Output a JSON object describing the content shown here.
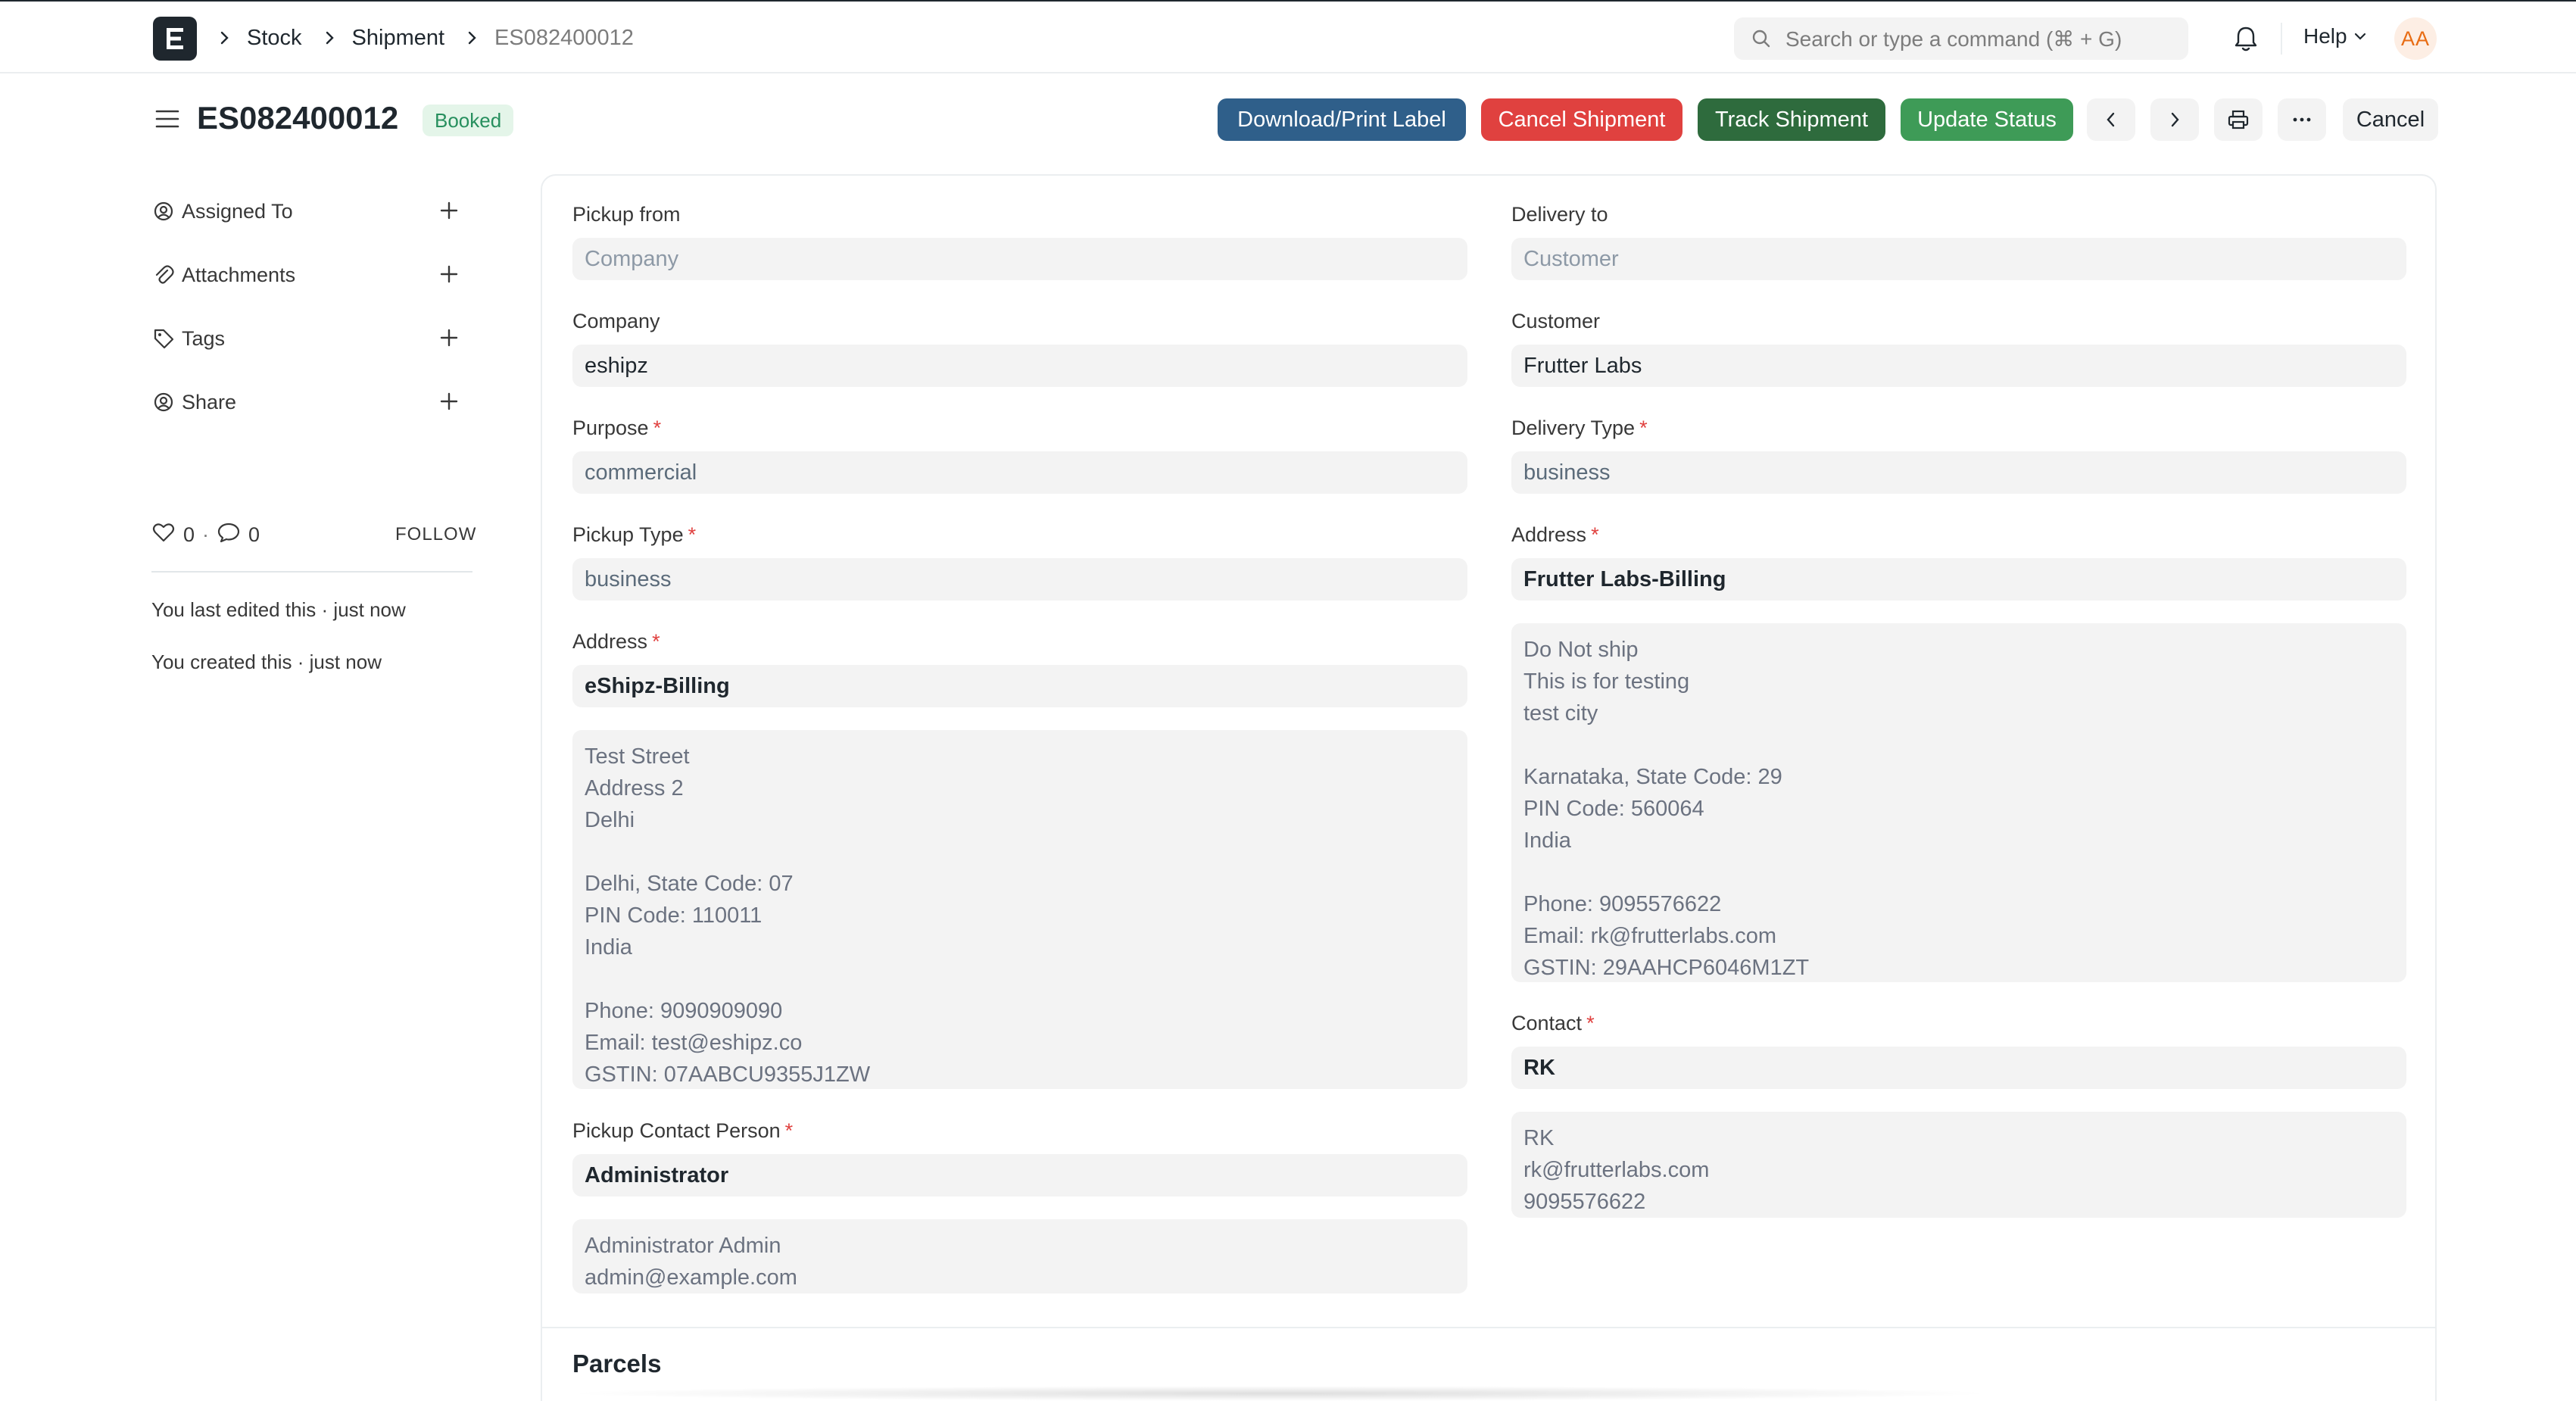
{
  "navbar": {
    "breadcrumbs": [
      "Stock",
      "Shipment",
      "ES082400012"
    ],
    "search_placeholder": "Search or type a command (⌘ + G)",
    "help_label": "Help",
    "avatar_initials": "AA"
  },
  "doc": {
    "title": "ES082400012",
    "status": "Booked"
  },
  "actions": {
    "download_print_label": "Download/Print Label",
    "cancel_shipment": "Cancel Shipment",
    "track_shipment": "Track Shipment",
    "update_status": "Update Status",
    "cancel": "Cancel"
  },
  "sidebar": {
    "items": [
      {
        "label": "Assigned To",
        "icon": "assign-icon"
      },
      {
        "label": "Attachments",
        "icon": "paperclip-icon"
      },
      {
        "label": "Tags",
        "icon": "tag-icon"
      },
      {
        "label": "Share",
        "icon": "share-icon"
      }
    ],
    "likes": "0",
    "comments": "0",
    "follow_label": "FOLLOW",
    "timeline": [
      "You last edited this · just now",
      "You created this · just now"
    ]
  },
  "form": {
    "left": {
      "pickup_from": {
        "label": "Pickup from",
        "placeholder": "Company"
      },
      "company": {
        "label": "Company",
        "value": "eshipz"
      },
      "purpose": {
        "label": "Purpose",
        "value": "commercial"
      },
      "pickup_type": {
        "label": "Pickup Type",
        "value": "business"
      },
      "address": {
        "label": "Address",
        "value": "eShipz-Billing"
      },
      "address_display": [
        "Test Street",
        "Address 2",
        "Delhi",
        "",
        "Delhi, State Code: 07",
        "PIN Code: 110011",
        "India",
        "",
        "Phone: 9090909090",
        "Email: test@eshipz.co",
        "GSTIN: 07AABCU9355J1ZW"
      ],
      "pickup_contact_person": {
        "label": "Pickup Contact Person",
        "value": "Administrator"
      },
      "contact_display": [
        "Administrator Admin",
        "admin@example.com"
      ]
    },
    "right": {
      "delivery_to": {
        "label": "Delivery to",
        "placeholder": "Customer"
      },
      "customer": {
        "label": "Customer",
        "value": "Frutter Labs"
      },
      "delivery_type": {
        "label": "Delivery Type",
        "value": "business"
      },
      "address": {
        "label": "Address",
        "value": "Frutter Labs-Billing"
      },
      "address_display": [
        "Do Not ship",
        "This is for testing",
        "test city",
        "",
        "Karnataka, State Code: 29",
        "PIN Code: 560064",
        "India",
        "",
        "Phone: 9095576622",
        "Email: rk@frutterlabs.com",
        "GSTIN: 29AAHCP6046M1ZT"
      ],
      "contact": {
        "label": "Contact",
        "value": "RK"
      },
      "contact_display": [
        "RK",
        "rk@frutterlabs.com",
        "9095576622"
      ]
    },
    "parcels_section_title": "Parcels"
  }
}
